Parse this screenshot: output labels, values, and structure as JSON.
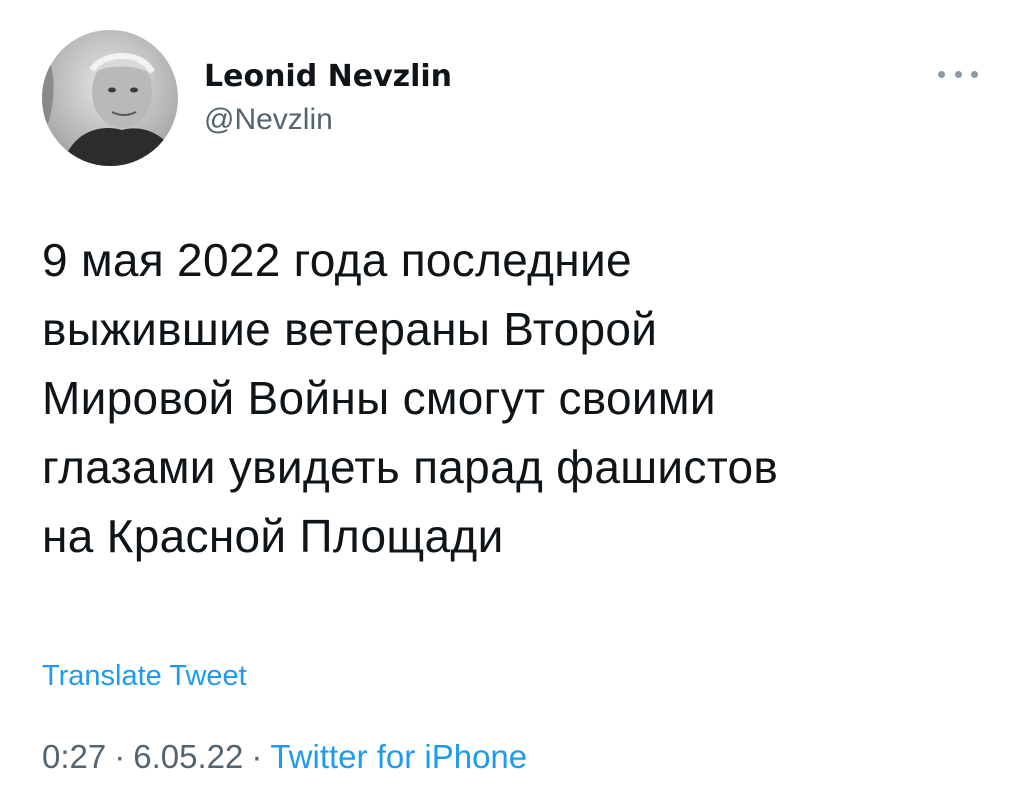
{
  "author": {
    "display_name": "Leonid Nevzlin",
    "handle": "@Nevzlin"
  },
  "tweet": {
    "text": "9 мая 2022 года последние\nвыжившие ветераны Второй\nМировой Войны смогут своими\nглазами увидеть парад фашистов\nна Красной Площади",
    "translate_label": "Translate Tweet",
    "time": "0:27",
    "separator": "·",
    "date": "6.05.22",
    "source": "Twitter for iPhone"
  },
  "icons": {
    "more": "more-horizontal-icon",
    "avatar": "profile-photo"
  },
  "colors": {
    "link": "#1d9bf0",
    "secondary_text": "#536471",
    "primary_text": "#0f1419"
  }
}
